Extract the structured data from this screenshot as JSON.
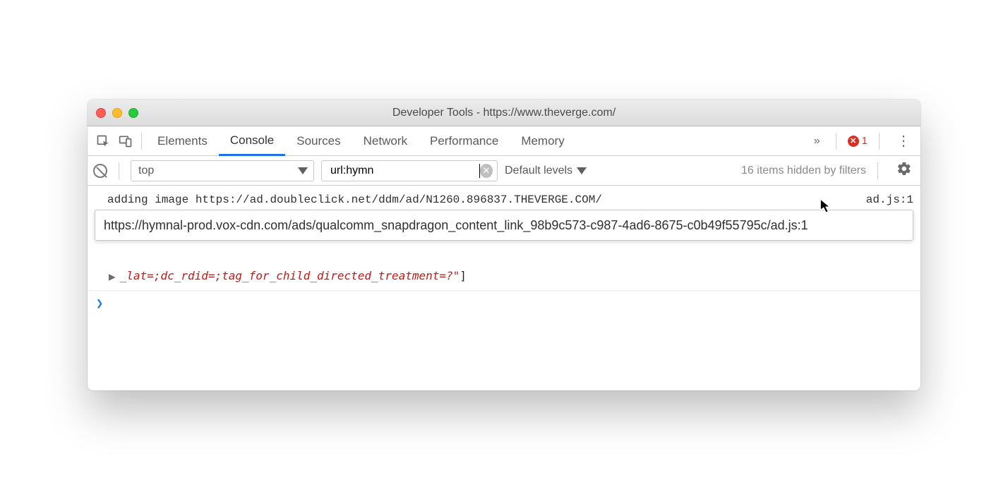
{
  "window": {
    "title": "Developer Tools - https://www.theverge.com/"
  },
  "tabs": {
    "items": [
      "Elements",
      "Console",
      "Sources",
      "Network",
      "Performance",
      "Memory"
    ],
    "active_index": 1,
    "overflow_glyph": "»",
    "error_count": "1"
  },
  "filterbar": {
    "context": "top",
    "filter_value": "url:hymn",
    "levels_label": "Default levels",
    "hidden_msg": "16 items hidden by filters"
  },
  "console": {
    "log1_msg": "adding image  https://ad.doubleclick.net/ddm/ad/N1260.896837.THEVERGE.COM/",
    "log1_src": "ad.js:1",
    "tooltip_text": "https://hymnal-prod.vox-cdn.com/ads/qualcomm_snapdragon_content_link_98b9c573-c987-4ad6-8675-c0b49f55795c/ad.js:1",
    "arr_text": "_lat=;dc_rdid=;tag_for_child_directed_treatment=?\"",
    "arr_close": "]",
    "prompt_glyph": "❯"
  }
}
